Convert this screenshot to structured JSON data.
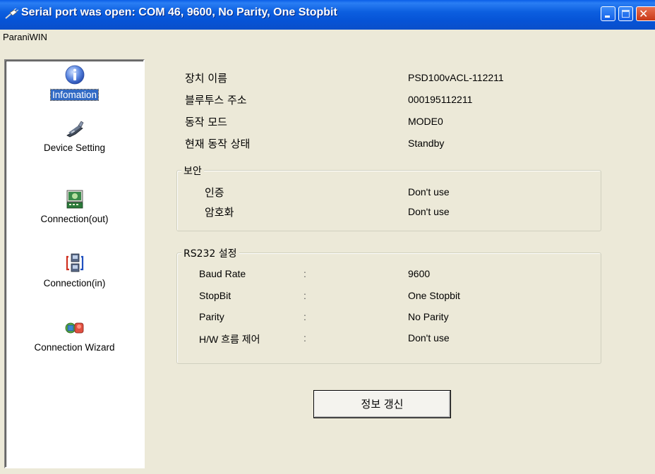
{
  "window": {
    "title": "Serial port was open: COM 46, 9600, No Parity, One Stopbit"
  },
  "menu": {
    "items": [
      "ParaniWIN"
    ]
  },
  "sidebar": {
    "items": [
      {
        "label": "Infomation",
        "icon": "info-icon",
        "selected": true
      },
      {
        "label": "Device Setting",
        "icon": "device-icon",
        "selected": false
      },
      {
        "label": "Connection(out)",
        "icon": "connection-out-icon",
        "selected": false
      },
      {
        "label": "Connection(in)",
        "icon": "connection-in-icon",
        "selected": false
      },
      {
        "label": "Connection Wizard",
        "icon": "wizard-icon",
        "selected": false
      }
    ]
  },
  "info": {
    "device_name_label": "장치 이름",
    "device_name_value": "PSD100vACL-112211",
    "bt_address_label": "블루투스 주소",
    "bt_address_value": "000195112211",
    "mode_label": "동작 모드",
    "mode_value": "MODE0",
    "status_label": "현재 동작 상태",
    "status_value": "Standby"
  },
  "security": {
    "title": "보안",
    "auth_label": "인증",
    "auth_value": "Don't use",
    "encrypt_label": "암호화",
    "encrypt_value": "Don't use"
  },
  "rs232": {
    "title": "RS232 설정",
    "rows": [
      {
        "label": "Baud Rate",
        "colon": ":",
        "value": "9600"
      },
      {
        "label": "StopBit",
        "colon": ":",
        "value": "One Stopbit"
      },
      {
        "label": "Parity",
        "colon": ":",
        "value": "No Parity"
      },
      {
        "label": "H/W 흐름 제어",
        "colon": ":",
        "value": "Don't use"
      }
    ]
  },
  "refresh_button": {
    "label": "정보 갱신"
  },
  "colors": {
    "titlebar": "#0a5ee8",
    "background": "#ece9d8",
    "selection": "#316ac5"
  }
}
